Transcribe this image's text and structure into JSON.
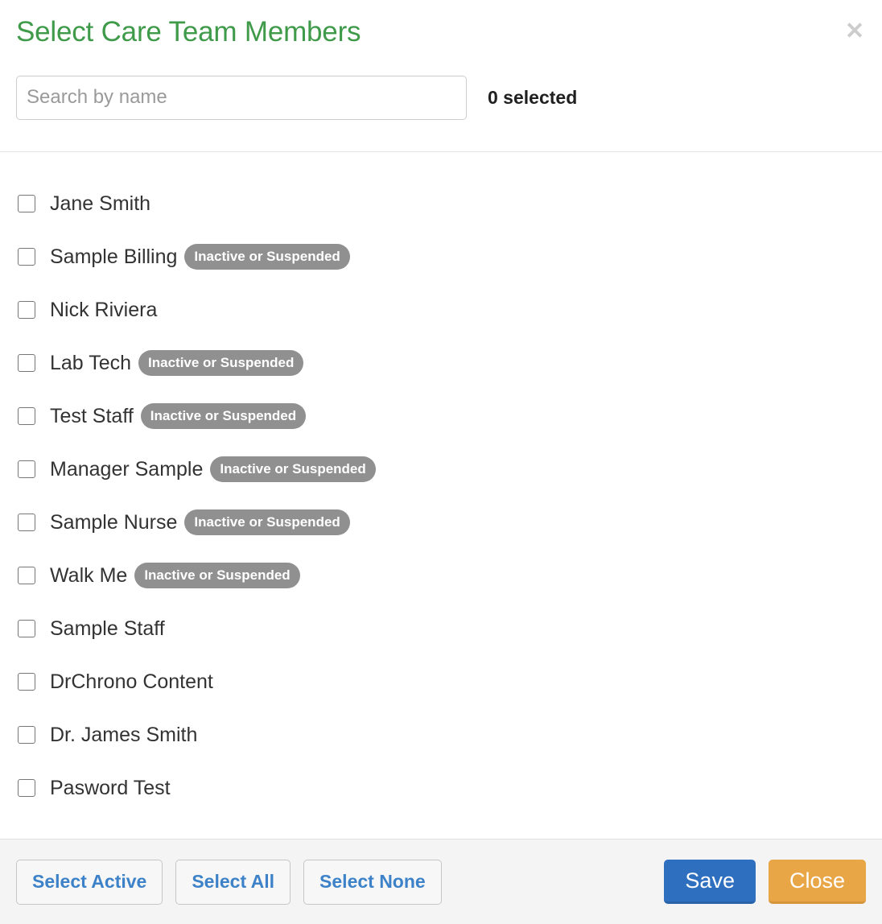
{
  "modal": {
    "title": "Select Care Team Members",
    "close_icon": "✕"
  },
  "search": {
    "value": "",
    "placeholder": "Search by name"
  },
  "selection": {
    "summary": "0 selected",
    "count": 0
  },
  "members": [
    {
      "name": "Jane Smith",
      "checked": false,
      "badge": null
    },
    {
      "name": "Sample Billing",
      "checked": false,
      "badge": "Inactive or Suspended"
    },
    {
      "name": "Nick Riviera",
      "checked": false,
      "badge": null
    },
    {
      "name": "Lab Tech",
      "checked": false,
      "badge": "Inactive or Suspended"
    },
    {
      "name": "Test Staff",
      "checked": false,
      "badge": "Inactive or Suspended"
    },
    {
      "name": "Manager Sample",
      "checked": false,
      "badge": "Inactive or Suspended"
    },
    {
      "name": "Sample Nurse",
      "checked": false,
      "badge": "Inactive or Suspended"
    },
    {
      "name": "Walk Me",
      "checked": false,
      "badge": "Inactive or Suspended"
    },
    {
      "name": "Sample Staff",
      "checked": false,
      "badge": null
    },
    {
      "name": "DrChrono Content",
      "checked": false,
      "badge": null
    },
    {
      "name": "Dr. James Smith",
      "checked": false,
      "badge": null
    },
    {
      "name": "Pasword Test",
      "checked": false,
      "badge": null
    }
  ],
  "footer": {
    "select_active_label": "Select Active",
    "select_all_label": "Select All",
    "select_none_label": "Select None",
    "save_label": "Save",
    "close_label": "Close"
  },
  "colors": {
    "title_green": "#3f9a4a",
    "link_blue": "#3d82c8",
    "save_blue": "#2f6fbf",
    "close_orange": "#e9a646",
    "badge_gray": "#909090",
    "footer_bg": "#f4f4f4",
    "close_icon_gray": "#cccccc"
  }
}
